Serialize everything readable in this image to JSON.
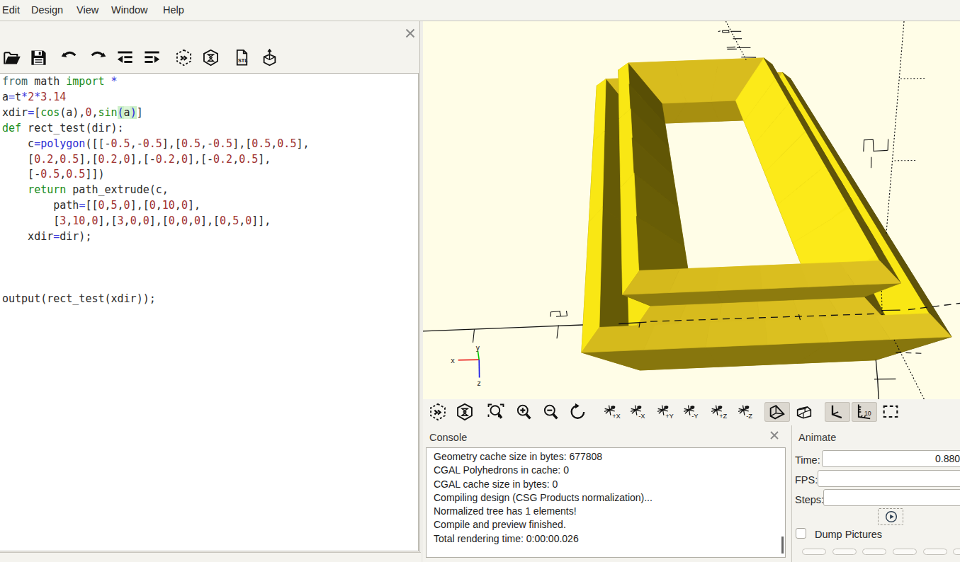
{
  "menu": {
    "items": [
      {
        "label": "Edit"
      },
      {
        "label": "Design"
      },
      {
        "label": "View"
      },
      {
        "label": "Window"
      },
      {
        "label": "Help"
      }
    ]
  },
  "editor": {
    "toolbar": [
      {
        "name": "open"
      },
      {
        "name": "save"
      },
      {
        "name": "undo"
      },
      {
        "name": "redo"
      },
      {
        "name": "unindent"
      },
      {
        "name": "indent"
      },
      {
        "name": "render-preview"
      },
      {
        "name": "render"
      },
      {
        "name": "export-stl"
      },
      {
        "name": "export-3d"
      }
    ],
    "close_label": "×",
    "code": [
      [
        [
          "from",
          "kw2"
        ],
        [
          " math ",
          "id"
        ],
        [
          "import",
          "kw"
        ],
        [
          " ",
          "id"
        ],
        [
          "*",
          "op"
        ]
      ],
      [
        [
          "a",
          "id"
        ],
        [
          "=",
          "op"
        ],
        [
          "t",
          "id"
        ],
        [
          "*",
          "op"
        ],
        [
          "2",
          "num"
        ],
        [
          "*",
          "op"
        ],
        [
          "3.14",
          "num"
        ]
      ],
      [
        [
          "xdir",
          "id"
        ],
        [
          "=",
          "op"
        ],
        [
          "[",
          "id"
        ],
        [
          "cos",
          "kw"
        ],
        [
          "(a),",
          "id"
        ],
        [
          "0",
          "num"
        ],
        [
          ",",
          "id"
        ],
        [
          "sin",
          "kw"
        ],
        [
          "(",
          "brace"
        ],
        [
          "a",
          "bracein"
        ],
        [
          ")",
          "brace"
        ],
        [
          "]",
          "id"
        ]
      ],
      [
        [
          "def",
          "kw"
        ],
        [
          " rect_test(dir):",
          "id"
        ]
      ],
      [
        [
          "    c",
          "id"
        ],
        [
          "=",
          "op"
        ],
        [
          "polygon",
          "fn"
        ],
        [
          "([[-",
          "id"
        ],
        [
          "0.5",
          "num"
        ],
        [
          ",-",
          "id"
        ],
        [
          "0.5",
          "num"
        ],
        [
          "],[",
          "id"
        ],
        [
          "0.5",
          "num"
        ],
        [
          ",-",
          "id"
        ],
        [
          "0.5",
          "num"
        ],
        [
          "],[",
          "id"
        ],
        [
          "0.5",
          "num"
        ],
        [
          ",",
          "id"
        ],
        [
          "0.5",
          "num"
        ],
        [
          "],",
          "id"
        ]
      ],
      [
        [
          "    [",
          "id"
        ],
        [
          "0.2",
          "num"
        ],
        [
          ",",
          "id"
        ],
        [
          "0.5",
          "num"
        ],
        [
          "],[",
          "id"
        ],
        [
          "0.2",
          "num"
        ],
        [
          ",",
          "id"
        ],
        [
          "0",
          "num"
        ],
        [
          "],[-",
          "id"
        ],
        [
          "0.2",
          "num"
        ],
        [
          ",",
          "id"
        ],
        [
          "0",
          "num"
        ],
        [
          "],[-",
          "id"
        ],
        [
          "0.2",
          "num"
        ],
        [
          ",",
          "id"
        ],
        [
          "0.5",
          "num"
        ],
        [
          "],",
          "id"
        ]
      ],
      [
        [
          "    [-",
          "id"
        ],
        [
          "0.5",
          "num"
        ],
        [
          ",",
          "id"
        ],
        [
          "0.5",
          "num"
        ],
        [
          "]])",
          "id"
        ]
      ],
      [
        [
          "    ",
          "id"
        ],
        [
          "return",
          "kw"
        ],
        [
          " path_extrude(c,",
          "id"
        ]
      ],
      [
        [
          "        path",
          "id"
        ],
        [
          "=",
          "op"
        ],
        [
          "[[",
          "id"
        ],
        [
          "0",
          "num"
        ],
        [
          ",",
          "id"
        ],
        [
          "5",
          "num"
        ],
        [
          ",",
          "id"
        ],
        [
          "0",
          "num"
        ],
        [
          "],[",
          "id"
        ],
        [
          "0",
          "num"
        ],
        [
          ",",
          "id"
        ],
        [
          "10",
          "num"
        ],
        [
          ",",
          "id"
        ],
        [
          "0",
          "num"
        ],
        [
          "],",
          "id"
        ]
      ],
      [
        [
          "        [",
          "id"
        ],
        [
          "3",
          "num"
        ],
        [
          ",",
          "id"
        ],
        [
          "10",
          "num"
        ],
        [
          ",",
          "id"
        ],
        [
          "0",
          "num"
        ],
        [
          "],[",
          "id"
        ],
        [
          "3",
          "num"
        ],
        [
          ",",
          "id"
        ],
        [
          "0",
          "num"
        ],
        [
          ",",
          "id"
        ],
        [
          "0",
          "num"
        ],
        [
          "],[",
          "id"
        ],
        [
          "0",
          "num"
        ],
        [
          ",",
          "id"
        ],
        [
          "0",
          "num"
        ],
        [
          ",",
          "id"
        ],
        [
          "0",
          "num"
        ],
        [
          "],[",
          "id"
        ],
        [
          "0",
          "num"
        ],
        [
          ",",
          "id"
        ],
        [
          "5",
          "num"
        ],
        [
          ",",
          "id"
        ],
        [
          "0",
          "num"
        ],
        [
          "]],",
          "id"
        ]
      ],
      [
        [
          "    xdir",
          "id"
        ],
        [
          "=",
          "op"
        ],
        [
          "dir);",
          "id"
        ]
      ],
      [],
      [],
      [],
      [
        [
          "output(rect_test(xdir));",
          "id"
        ]
      ]
    ]
  },
  "viewport": {
    "bg": "#fffde7",
    "object_color": "#f9e714"
  },
  "view_toolbar": [
    {
      "name": "render-preview"
    },
    {
      "name": "render"
    },
    {
      "name": "zoom-fit"
    },
    {
      "name": "zoom-in"
    },
    {
      "name": "zoom-out"
    },
    {
      "name": "reset-view"
    },
    {
      "name": "view-px",
      "label": "+X"
    },
    {
      "name": "view-mx",
      "label": "-X"
    },
    {
      "name": "view-py",
      "label": "+Y"
    },
    {
      "name": "view-my",
      "label": "-Y"
    },
    {
      "name": "view-pz",
      "label": "+Z"
    },
    {
      "name": "view-mz",
      "label": "-Z"
    },
    {
      "name": "perspective",
      "pressed": true
    },
    {
      "name": "orthographic"
    },
    {
      "name": "show-axes",
      "pressed": true
    },
    {
      "name": "show-scale-markers",
      "pressed": true
    },
    {
      "name": "view-all"
    }
  ],
  "console": {
    "title": "Console",
    "close_label": "×",
    "lines": [
      "Geometry cache size in bytes: 677808",
      "CGAL Polyhedrons in cache: 0",
      "CGAL cache size in bytes: 0",
      "Compiling design (CSG Products normalization)...",
      "Normalized tree has 1 elements!",
      "Compile and preview finished.",
      "Total rendering time: 0:00:00.026"
    ]
  },
  "animate": {
    "title": "Animate",
    "time_label": "Time:",
    "time_value": "0.880",
    "fps_label": "FPS:",
    "fps_value": "",
    "steps_label": "Steps:",
    "steps_value": "",
    "dump_label": "Dump Pictures"
  },
  "gizmo": {
    "x": "x",
    "y": "y",
    "z": "z"
  }
}
